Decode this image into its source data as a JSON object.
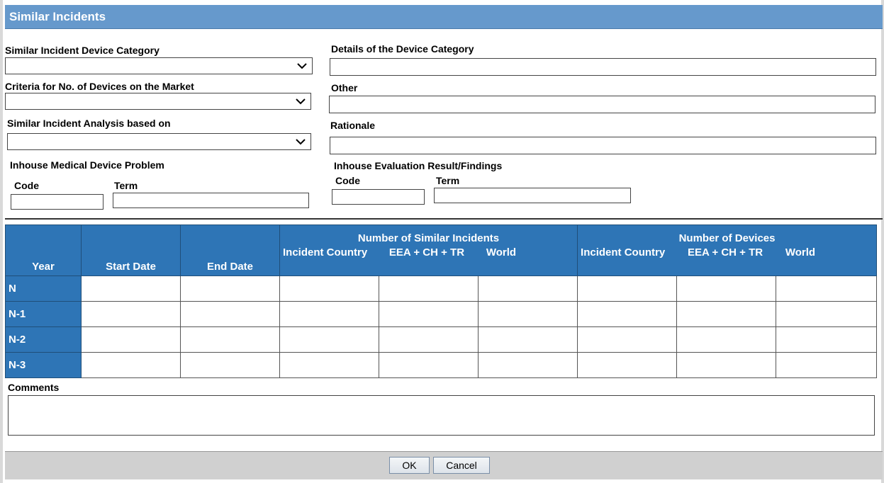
{
  "dialog": {
    "title": "Similar Incidents"
  },
  "left": {
    "device_category_label": "Similar Incident Device Category",
    "criteria_label": "Criteria for No. of Devices on the Market",
    "analysis_label": "Similar Incident Analysis based on",
    "inhouse_problem_label": "Inhouse Medical Device Problem",
    "code_label": "Code",
    "term_label": "Term"
  },
  "right": {
    "details_label": "Details of the Device Category",
    "other_label": "Other",
    "rationale_label": "Rationale",
    "inhouse_eval_label": "Inhouse Evaluation Result/Findings",
    "code_label": "Code",
    "term_label": "Term"
  },
  "table": {
    "year_header": "Year",
    "start_header": "Start Date",
    "end_header": "End Date",
    "similar_group": "Number of Similar Incidents",
    "devices_group": "Number of Devices",
    "sub_incident_country": "Incident Country",
    "sub_eea": "EEA + CH + TR",
    "sub_world": "World",
    "rows": [
      "N",
      "N-1",
      "N-2",
      "N-3"
    ]
  },
  "comments": {
    "label": "Comments"
  },
  "footer": {
    "ok_label": "OK",
    "cancel_label": "Cancel"
  },
  "colors": {
    "title_bar": "#6699cc",
    "table_header": "#2e75b6",
    "footer": "#d0d0d0"
  }
}
